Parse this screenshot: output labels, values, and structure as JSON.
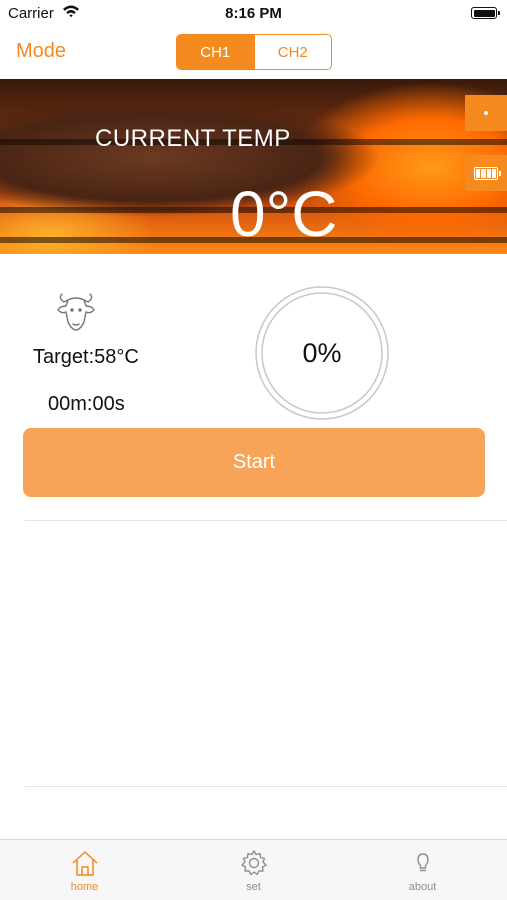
{
  "status_bar": {
    "carrier": "Carrier",
    "time": "8:16 PM"
  },
  "nav": {
    "mode_label": "Mode",
    "channels": [
      {
        "label": "CH1",
        "active": true
      },
      {
        "label": "CH2",
        "active": false
      }
    ]
  },
  "hero": {
    "title": "CURRENT TEMP",
    "temperature": "0°C"
  },
  "info": {
    "target": "Target:58°C",
    "timer": "00m:00s",
    "progress": "0%"
  },
  "start_label": "Start",
  "tabs": [
    {
      "label": "home",
      "icon": "home-icon",
      "active": true
    },
    {
      "label": "set",
      "icon": "gear-icon",
      "active": false
    },
    {
      "label": "about",
      "icon": "lightbulb-icon",
      "active": false
    }
  ],
  "colors": {
    "accent": "#f58a1f",
    "start_button": "#f8a458"
  }
}
